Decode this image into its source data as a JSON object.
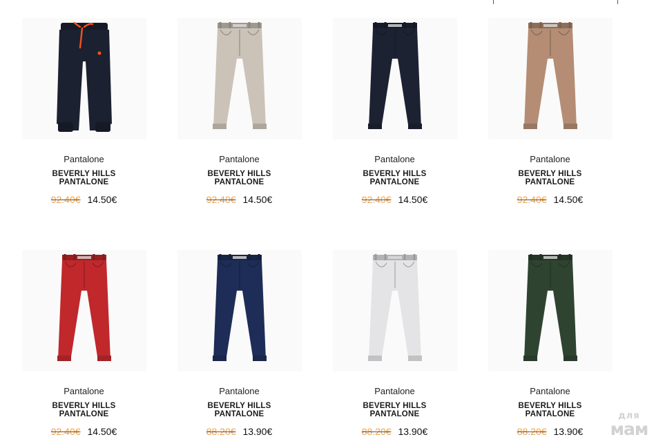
{
  "products": [
    {
      "category": "Pantalone",
      "name_line1": "BEVERLY HILLS",
      "name_line2": "PANTALONE",
      "old_price": "92.40€",
      "new_price": "14.50€",
      "color": "#1c2131",
      "style": "jogger",
      "icon": "pants-icon"
    },
    {
      "category": "Pantalone",
      "name_line1": "BEVERLY HILLS",
      "name_line2": "PANTALONE",
      "old_price": "92.40€",
      "new_price": "14.50€",
      "color": "#cbc3b8",
      "style": "chino",
      "icon": "pants-icon"
    },
    {
      "category": "Pantalone",
      "name_line1": "BEVERLY HILLS",
      "name_line2": "PANTALONE",
      "old_price": "92.40€",
      "new_price": "14.50€",
      "color": "#1d2233",
      "style": "chino",
      "icon": "pants-icon"
    },
    {
      "category": "Pantalone",
      "name_line1": "BEVERLY HILLS",
      "name_line2": "PANTALONE",
      "old_price": "92.40€",
      "new_price": "14.50€",
      "color": "#b48d74",
      "style": "chino",
      "icon": "pants-icon"
    },
    {
      "category": "Pantalone",
      "name_line1": "BEVERLY HILLS",
      "name_line2": "PANTALONE",
      "old_price": "92.40€",
      "new_price": "14.50€",
      "color": "#c0282c",
      "style": "chino",
      "icon": "pants-icon"
    },
    {
      "category": "Pantalone",
      "name_line1": "BEVERLY HILLS",
      "name_line2": "PANTALONE",
      "old_price": "88.20€",
      "new_price": "13.90€",
      "color": "#1e2d57",
      "style": "chino",
      "icon": "pants-icon"
    },
    {
      "category": "Pantalone",
      "name_line1": "BEVERLY HILLS",
      "name_line2": "PANTALONE",
      "old_price": "88.20€",
      "new_price": "13.90€",
      "color": "#e4e4e6",
      "style": "chino",
      "icon": "pants-icon"
    },
    {
      "category": "Pantalone",
      "name_line1": "BEVERLY HILLS",
      "name_line2": "PANTALONE",
      "old_price": "88.20€",
      "new_price": "13.90€",
      "color": "#2f4430",
      "style": "chino",
      "icon": "pants-icon"
    }
  ],
  "colors": {
    "old_price": "#f0a14a",
    "drawstring": "#f2541b"
  },
  "watermark": {
    "line1": "для",
    "line2": "мам"
  }
}
